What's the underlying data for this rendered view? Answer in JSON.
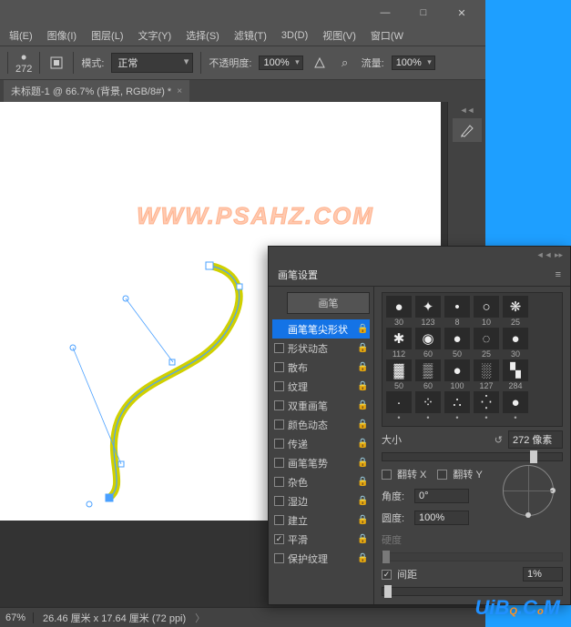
{
  "menubar": {
    "edit": "辑(E)",
    "image": "图像(I)",
    "layer": "图层(L)",
    "type": "文字(Y)",
    "select": "选择(S)",
    "filter": "滤镜(T)",
    "threed": "3D(D)",
    "view": "视图(V)",
    "window": "窗口(W"
  },
  "optbar": {
    "brush_size": "272",
    "mode_label": "模式:",
    "mode_value": "正常",
    "opacity_label": "不透明度:",
    "opacity_value": "100%",
    "flow_label": "流量:",
    "flow_value": "100%"
  },
  "tab": {
    "title": "未标题-1 @ 66.7% (背景, RGB/8#) *"
  },
  "watermark": "WWW.PSAHZ.COM",
  "status": {
    "zoom": "67%",
    "dims": "26.46 厘米 x 17.64 厘米 (72 ppi)"
  },
  "panel": {
    "title": "画笔设置",
    "brush_tab": "画笔",
    "rows": [
      {
        "label": "画笔笔尖形状",
        "sel": true,
        "nocb": true
      },
      {
        "label": "形状动态",
        "checked": false
      },
      {
        "label": "散布",
        "checked": false
      },
      {
        "label": "纹理",
        "checked": false
      },
      {
        "label": "双重画笔",
        "checked": false
      },
      {
        "label": "颜色动态",
        "checked": false
      },
      {
        "label": "传递",
        "checked": false
      },
      {
        "label": "画笔笔势",
        "checked": false
      },
      {
        "label": "杂色",
        "checked": false
      },
      {
        "label": "湿边",
        "checked": false
      },
      {
        "label": "建立",
        "checked": false
      },
      {
        "label": "平滑",
        "checked": true
      },
      {
        "label": "保护纹理",
        "checked": false
      }
    ],
    "presets": [
      [
        "30",
        "123",
        "8",
        "10",
        "25"
      ],
      [
        "112",
        "60",
        "50",
        "25",
        "30"
      ],
      [
        "50",
        "60",
        "100",
        "127",
        "284"
      ],
      [
        "•",
        "•",
        "•",
        "•",
        "•"
      ]
    ],
    "size_label": "大小",
    "size_value": "272 像素",
    "flipx": "翻转 X",
    "flipy": "翻转 Y",
    "angle_label": "角度:",
    "angle_value": "0°",
    "round_label": "圆度:",
    "round_value": "100%",
    "hardness_label": "硬度",
    "spacing_label": "间距",
    "spacing_value": "1%"
  },
  "uibq": "UiBQ.CoM"
}
